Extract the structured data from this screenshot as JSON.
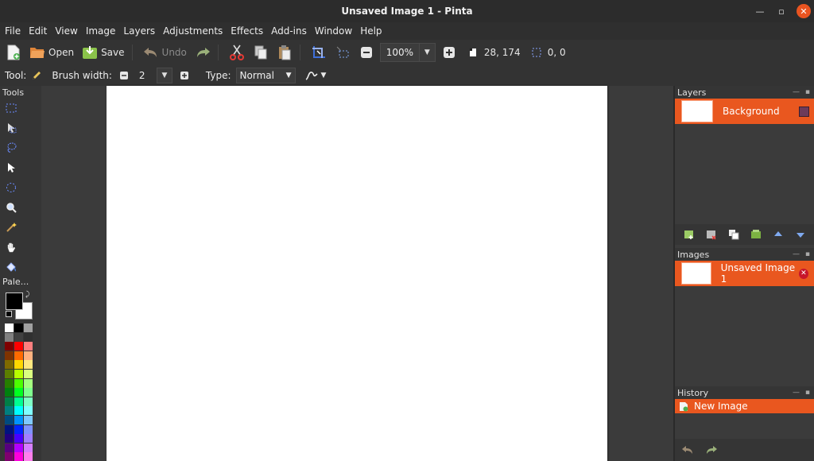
{
  "window": {
    "title": "Unsaved Image 1 - Pinta"
  },
  "menu": [
    "File",
    "Edit",
    "View",
    "Image",
    "Layers",
    "Adjustments",
    "Effects",
    "Add-ins",
    "Window",
    "Help"
  ],
  "toolbar": {
    "open_label": "Open",
    "save_label": "Save",
    "undo_label": "Undo",
    "zoom_value": "100%",
    "cursor_pos": "28, 174",
    "selection_size": "0, 0"
  },
  "options": {
    "tool_label": "Tool:",
    "brush_width_label": "Brush width:",
    "brush_width_value": "2",
    "type_label": "Type:",
    "type_value": "Normal"
  },
  "tools_panel": {
    "title": "Tools"
  },
  "palette_panel": {
    "title": "Pale...",
    "primary_color": "#000000",
    "secondary_color": "#ffffff"
  },
  "layers_panel": {
    "title": "Layers",
    "layers": [
      {
        "name": "Background",
        "visible": true
      }
    ]
  },
  "images_panel": {
    "title": "Images",
    "images": [
      {
        "name": "Unsaved Image 1"
      }
    ]
  },
  "history_panel": {
    "title": "History",
    "items": [
      {
        "label": "New Image"
      }
    ]
  },
  "colors": {
    "accent": "#e9571f",
    "close": "#e95420"
  }
}
